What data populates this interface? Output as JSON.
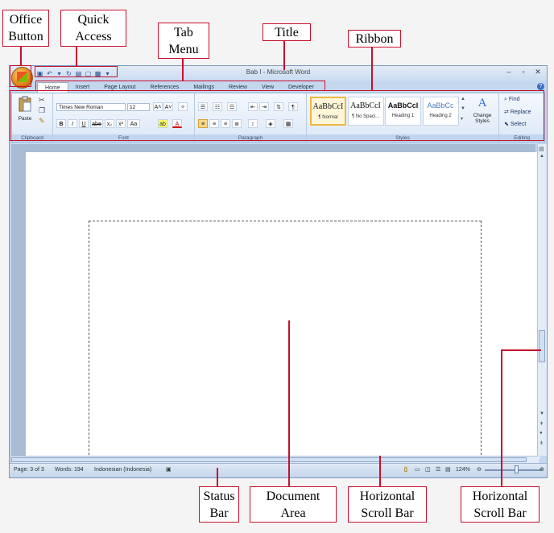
{
  "callouts": {
    "office_button": [
      "Office",
      "Button"
    ],
    "quick_access": [
      "Quick",
      "Access"
    ],
    "tab_menu": [
      "Tab",
      "Menu"
    ],
    "title": "Title",
    "ribbon": "Ribbon",
    "status_bar": [
      "Status",
      "Bar"
    ],
    "document_area": [
      "Document",
      "Area"
    ],
    "scroll_bar_bottom": [
      "Horizontal",
      "Scroll Bar"
    ],
    "scroll_bar_right": [
      "Horizontal",
      "Scroll Bar"
    ]
  },
  "window": {
    "title": "Bab I - Microsoft Word",
    "controls": [
      "–",
      "▫",
      "✕"
    ]
  },
  "tabs": [
    "Home",
    "Insert",
    "Page Layout",
    "References",
    "Mailings",
    "Review",
    "View",
    "Developer"
  ],
  "ribbon": {
    "clipboard": {
      "label": "Clipboard",
      "paste": "Paste"
    },
    "font": {
      "label": "Font",
      "font_name": "Times New Roman",
      "font_size": "12",
      "buttons": [
        "B",
        "I",
        "U",
        "abe",
        "x₂",
        "x²",
        "Aa"
      ]
    },
    "paragraph": {
      "label": "Paragraph"
    },
    "styles": {
      "label": "Styles",
      "items": [
        {
          "sample": "AaBbCcI",
          "name": "¶ Normal"
        },
        {
          "sample": "AaBbCcI",
          "name": "¶ No Spaci..."
        },
        {
          "sample": "AaBbCcI",
          "name": "Heading 1"
        },
        {
          "sample": "AaBbCc",
          "name": "Heading 2"
        }
      ],
      "change_styles": [
        "Change",
        "Styles"
      ]
    },
    "editing": {
      "label": "Editing",
      "find": "Find",
      "replace": "Replace",
      "select": "Select"
    }
  },
  "status": {
    "page": "Page: 3 of 3",
    "words": "Words: 194",
    "language": "Indonesian (Indonesia)",
    "zoom": "124%"
  },
  "colors": {
    "callout_border": "#c8102e",
    "ribbon": "#dce8f6",
    "highlight": "#f0b640"
  }
}
